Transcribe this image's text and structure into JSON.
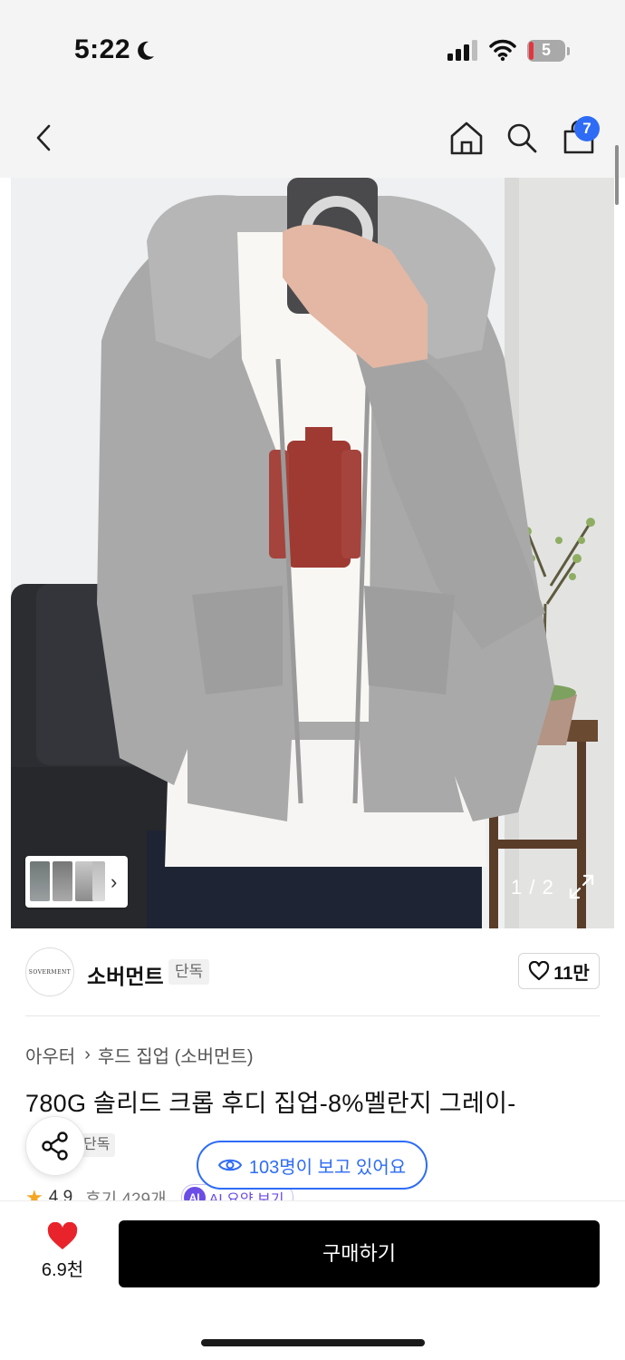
{
  "status_bar": {
    "time": "5:22",
    "battery_level": "5",
    "icons": [
      "moon-icon",
      "signal-icon",
      "wifi-icon",
      "battery-icon"
    ]
  },
  "nav": {
    "icons": [
      "back-arrow-icon",
      "home-icon",
      "search-icon",
      "cart-icon"
    ],
    "cart_count": "7"
  },
  "gallery": {
    "page_counter": "1 / 2",
    "icons": [
      "chevron-right-icon",
      "expand-icon"
    ]
  },
  "brand": {
    "logo_text": "SOVERMENT",
    "name": "소버먼트",
    "tag": "단독",
    "likes": "11만"
  },
  "product": {
    "breadcrumb": [
      "아우터",
      "후드 집업 (소버먼트)"
    ],
    "title": "780G 솔리드 크롭 후디 집업-8%멜란지 그레이-",
    "tag": "단독",
    "viewers": "103명이 보고 있어요",
    "rating": "4.9",
    "reviews": "후기 429개",
    "ai_badge": "AI",
    "ai_summary": "AI 요약 보기"
  },
  "bottom_bar": {
    "wish_count": "6.9천",
    "buy_label": "구매하기"
  },
  "colors": {
    "accent_blue": "#2e6cf6",
    "heart_red": "#e8232b",
    "buy_black": "#000000"
  }
}
